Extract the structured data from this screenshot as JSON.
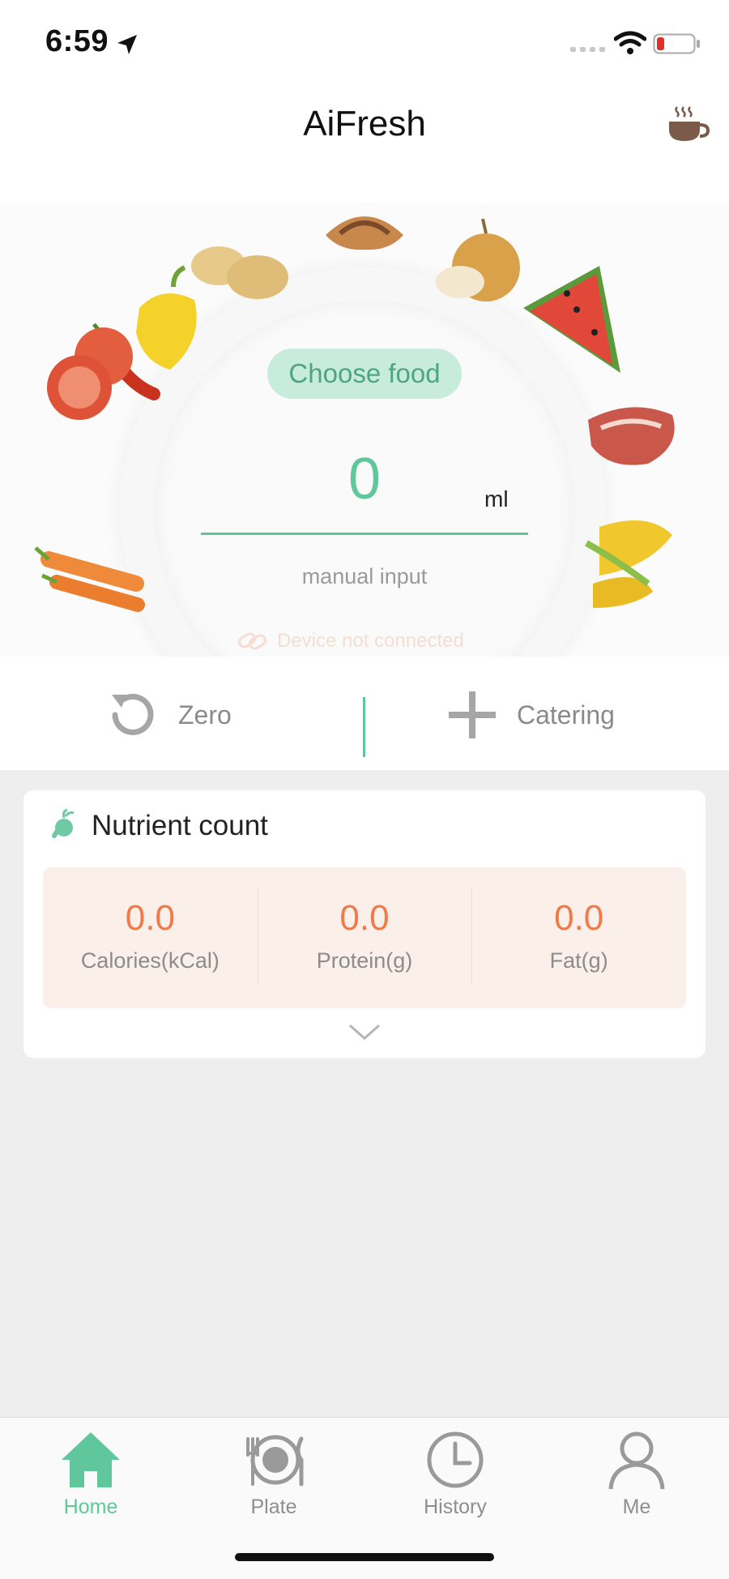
{
  "status": {
    "time": "6:59"
  },
  "header": {
    "title": "AiFresh",
    "right_icon": "coffee-icon"
  },
  "scale": {
    "choose_food_label": "Choose food",
    "value": "0",
    "unit": "ml",
    "manual_label": "manual input",
    "device_status": "Device not connected"
  },
  "actions": {
    "zero_label": "Zero",
    "catering_label": "Catering"
  },
  "nutrients": {
    "title": "Nutrient count",
    "items": [
      {
        "value": "0.0",
        "label": "Calories(kCal)"
      },
      {
        "value": "0.0",
        "label": "Protein(g)"
      },
      {
        "value": "0.0",
        "label": "Fat(g)"
      }
    ]
  },
  "tabs": [
    {
      "label": "Home",
      "icon": "home-icon",
      "active": true
    },
    {
      "label": "Plate",
      "icon": "plate-icon",
      "active": false
    },
    {
      "label": "History",
      "icon": "clock-icon",
      "active": false
    },
    {
      "label": "Me",
      "icon": "person-icon",
      "active": false
    }
  ],
  "colors": {
    "accent": "#5fc79b",
    "nutrient_value": "#ef7a4a",
    "nutrient_bg": "#fbefe9"
  }
}
